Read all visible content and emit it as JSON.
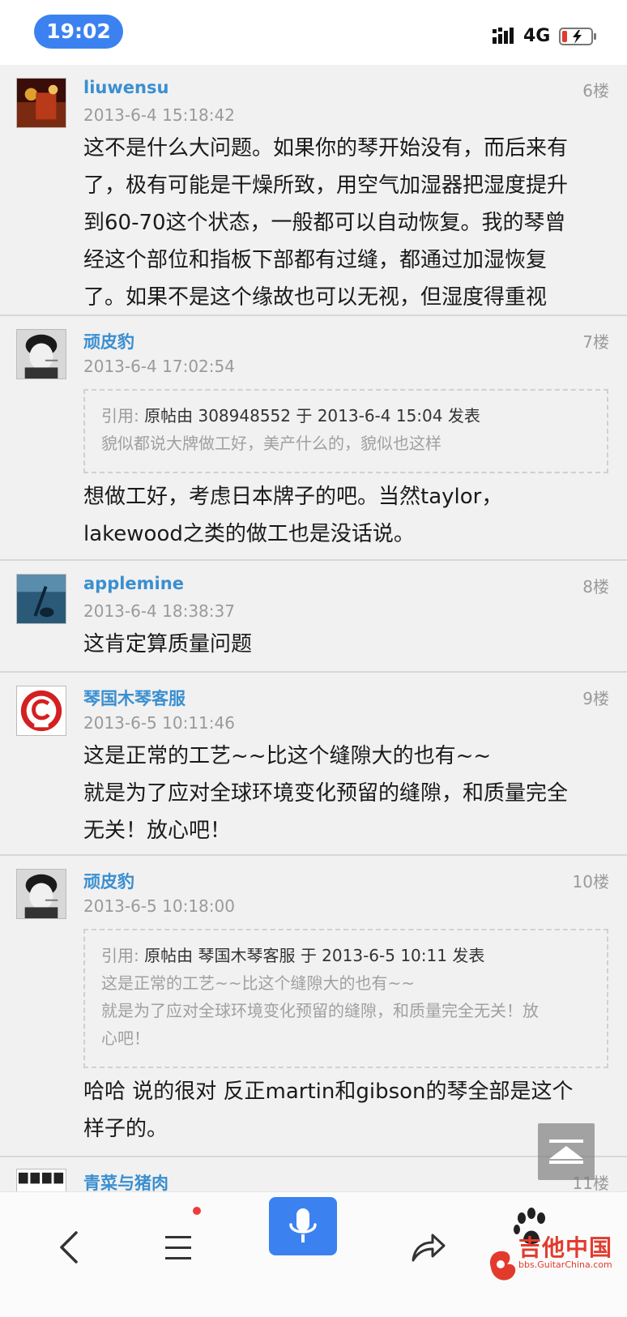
{
  "status_bar": {
    "time": "19:02",
    "network": "4G",
    "time_bg_color": "#3b82f0"
  },
  "posts": [
    {
      "username": "liuwensu",
      "floor": "6楼",
      "time": "2013-6-4 15:18:42",
      "content_lines": [
        "这不是什么大问题。如果你的琴开始没有，而后来有",
        "了，极有可能是干燥所致，用空气加湿器把湿度提升",
        "到60-70这个状态，一般都可以自动恢复。我的琴曾",
        "经这个部位和指板下部都有过缝，都通过加湿恢复",
        "了。如果不是这个缘故也可以无视，但湿度得重视"
      ]
    },
    {
      "username": "顽皮豹",
      "floor": "7楼",
      "time": "2013-6-4 17:02:54",
      "quote": {
        "label": "引用:",
        "header": "原帖由 308948552 于 2013-6-4 15:04 发表",
        "lines": [
          "貌似都说大牌做工好，美产什么的，貌似也这样"
        ]
      },
      "content_lines": [
        "想做工好，考虑日本牌子的吧。当然taylor，",
        "lakewood之类的做工也是没话说。"
      ]
    },
    {
      "username": "applemine",
      "floor": "8楼",
      "time": "2013-6-4 18:38:37",
      "content_lines": [
        "这肯定算质量问题"
      ]
    },
    {
      "username": "琴国木琴客服",
      "floor": "9楼",
      "time": "2013-6-5 10:11:46",
      "content_lines": [
        "这是正常的工艺~~比这个缝隙大的也有~~",
        "就是为了应对全球环境变化预留的缝隙，和质量完全",
        "无关！放心吧！"
      ]
    },
    {
      "username": "顽皮豹",
      "floor": "10楼",
      "time": "2013-6-5 10:18:00",
      "quote": {
        "label": "引用:",
        "header": "原帖由 琴国木琴客服 于 2013-6-5 10:11 发表",
        "lines": [
          "这是正常的工艺~~比这个缝隙大的也有~~",
          "就是为了应对全球环境变化预留的缝隙，和质量完全无关！放",
          "心吧！"
        ]
      },
      "content_lines": [
        "哈哈 说的很对 反正martin和gibson的琴全部是这个",
        "样子的。"
      ]
    },
    {
      "username": "青菜与猪肉",
      "floor": "11楼"
    }
  ],
  "toolbar": {
    "icons": [
      "back-arrow-icon",
      "menu-icon",
      "microphone-icon",
      "share-icon",
      "paw-icon"
    ],
    "accent_color": "#3b82f0",
    "badge_color": "#ee3b3b"
  },
  "watermark": {
    "title": "吉他中国",
    "url": "bbs.GuitarChina.com"
  },
  "colors": {
    "username": "#3a8fd0",
    "meta": "#9a9a9a",
    "post_bg": "#f1f1f1"
  }
}
